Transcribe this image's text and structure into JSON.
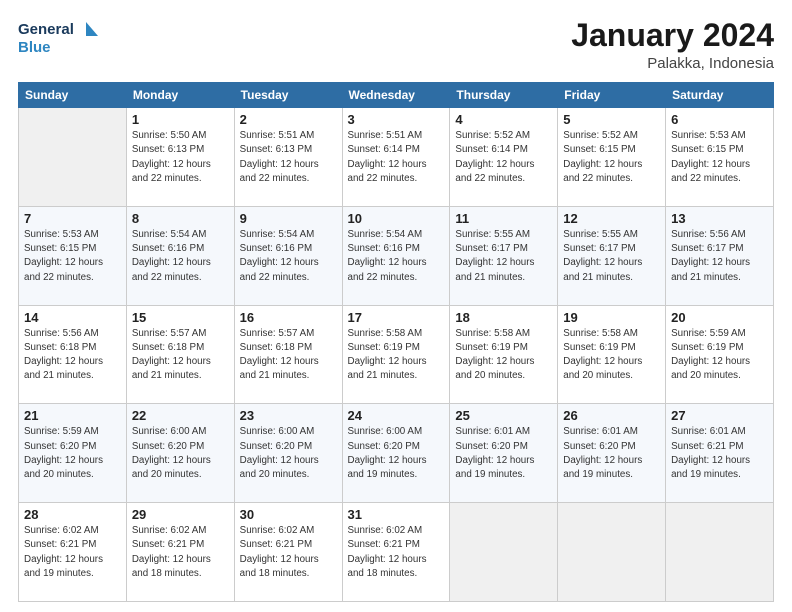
{
  "logo": {
    "line1": "General",
    "line2": "Blue"
  },
  "header": {
    "title": "January 2024",
    "subtitle": "Palakka, Indonesia"
  },
  "weekdays": [
    "Sunday",
    "Monday",
    "Tuesday",
    "Wednesday",
    "Thursday",
    "Friday",
    "Saturday"
  ],
  "weeks": [
    [
      {
        "day": "",
        "empty": true
      },
      {
        "day": "1",
        "sunrise": "5:50 AM",
        "sunset": "6:13 PM",
        "daylight": "12 hours and 22 minutes."
      },
      {
        "day": "2",
        "sunrise": "5:51 AM",
        "sunset": "6:13 PM",
        "daylight": "12 hours and 22 minutes."
      },
      {
        "day": "3",
        "sunrise": "5:51 AM",
        "sunset": "6:14 PM",
        "daylight": "12 hours and 22 minutes."
      },
      {
        "day": "4",
        "sunrise": "5:52 AM",
        "sunset": "6:14 PM",
        "daylight": "12 hours and 22 minutes."
      },
      {
        "day": "5",
        "sunrise": "5:52 AM",
        "sunset": "6:15 PM",
        "daylight": "12 hours and 22 minutes."
      },
      {
        "day": "6",
        "sunrise": "5:53 AM",
        "sunset": "6:15 PM",
        "daylight": "12 hours and 22 minutes."
      }
    ],
    [
      {
        "day": "7",
        "sunrise": "5:53 AM",
        "sunset": "6:15 PM",
        "daylight": "12 hours and 22 minutes."
      },
      {
        "day": "8",
        "sunrise": "5:54 AM",
        "sunset": "6:16 PM",
        "daylight": "12 hours and 22 minutes."
      },
      {
        "day": "9",
        "sunrise": "5:54 AM",
        "sunset": "6:16 PM",
        "daylight": "12 hours and 22 minutes."
      },
      {
        "day": "10",
        "sunrise": "5:54 AM",
        "sunset": "6:16 PM",
        "daylight": "12 hours and 22 minutes."
      },
      {
        "day": "11",
        "sunrise": "5:55 AM",
        "sunset": "6:17 PM",
        "daylight": "12 hours and 21 minutes."
      },
      {
        "day": "12",
        "sunrise": "5:55 AM",
        "sunset": "6:17 PM",
        "daylight": "12 hours and 21 minutes."
      },
      {
        "day": "13",
        "sunrise": "5:56 AM",
        "sunset": "6:17 PM",
        "daylight": "12 hours and 21 minutes."
      }
    ],
    [
      {
        "day": "14",
        "sunrise": "5:56 AM",
        "sunset": "6:18 PM",
        "daylight": "12 hours and 21 minutes."
      },
      {
        "day": "15",
        "sunrise": "5:57 AM",
        "sunset": "6:18 PM",
        "daylight": "12 hours and 21 minutes."
      },
      {
        "day": "16",
        "sunrise": "5:57 AM",
        "sunset": "6:18 PM",
        "daylight": "12 hours and 21 minutes."
      },
      {
        "day": "17",
        "sunrise": "5:58 AM",
        "sunset": "6:19 PM",
        "daylight": "12 hours and 21 minutes."
      },
      {
        "day": "18",
        "sunrise": "5:58 AM",
        "sunset": "6:19 PM",
        "daylight": "12 hours and 20 minutes."
      },
      {
        "day": "19",
        "sunrise": "5:58 AM",
        "sunset": "6:19 PM",
        "daylight": "12 hours and 20 minutes."
      },
      {
        "day": "20",
        "sunrise": "5:59 AM",
        "sunset": "6:19 PM",
        "daylight": "12 hours and 20 minutes."
      }
    ],
    [
      {
        "day": "21",
        "sunrise": "5:59 AM",
        "sunset": "6:20 PM",
        "daylight": "12 hours and 20 minutes."
      },
      {
        "day": "22",
        "sunrise": "6:00 AM",
        "sunset": "6:20 PM",
        "daylight": "12 hours and 20 minutes."
      },
      {
        "day": "23",
        "sunrise": "6:00 AM",
        "sunset": "6:20 PM",
        "daylight": "12 hours and 20 minutes."
      },
      {
        "day": "24",
        "sunrise": "6:00 AM",
        "sunset": "6:20 PM",
        "daylight": "12 hours and 19 minutes."
      },
      {
        "day": "25",
        "sunrise": "6:01 AM",
        "sunset": "6:20 PM",
        "daylight": "12 hours and 19 minutes."
      },
      {
        "day": "26",
        "sunrise": "6:01 AM",
        "sunset": "6:20 PM",
        "daylight": "12 hours and 19 minutes."
      },
      {
        "day": "27",
        "sunrise": "6:01 AM",
        "sunset": "6:21 PM",
        "daylight": "12 hours and 19 minutes."
      }
    ],
    [
      {
        "day": "28",
        "sunrise": "6:02 AM",
        "sunset": "6:21 PM",
        "daylight": "12 hours and 19 minutes."
      },
      {
        "day": "29",
        "sunrise": "6:02 AM",
        "sunset": "6:21 PM",
        "daylight": "12 hours and 18 minutes."
      },
      {
        "day": "30",
        "sunrise": "6:02 AM",
        "sunset": "6:21 PM",
        "daylight": "12 hours and 18 minutes."
      },
      {
        "day": "31",
        "sunrise": "6:02 AM",
        "sunset": "6:21 PM",
        "daylight": "12 hours and 18 minutes."
      },
      {
        "day": "",
        "empty": true
      },
      {
        "day": "",
        "empty": true
      },
      {
        "day": "",
        "empty": true
      }
    ]
  ]
}
